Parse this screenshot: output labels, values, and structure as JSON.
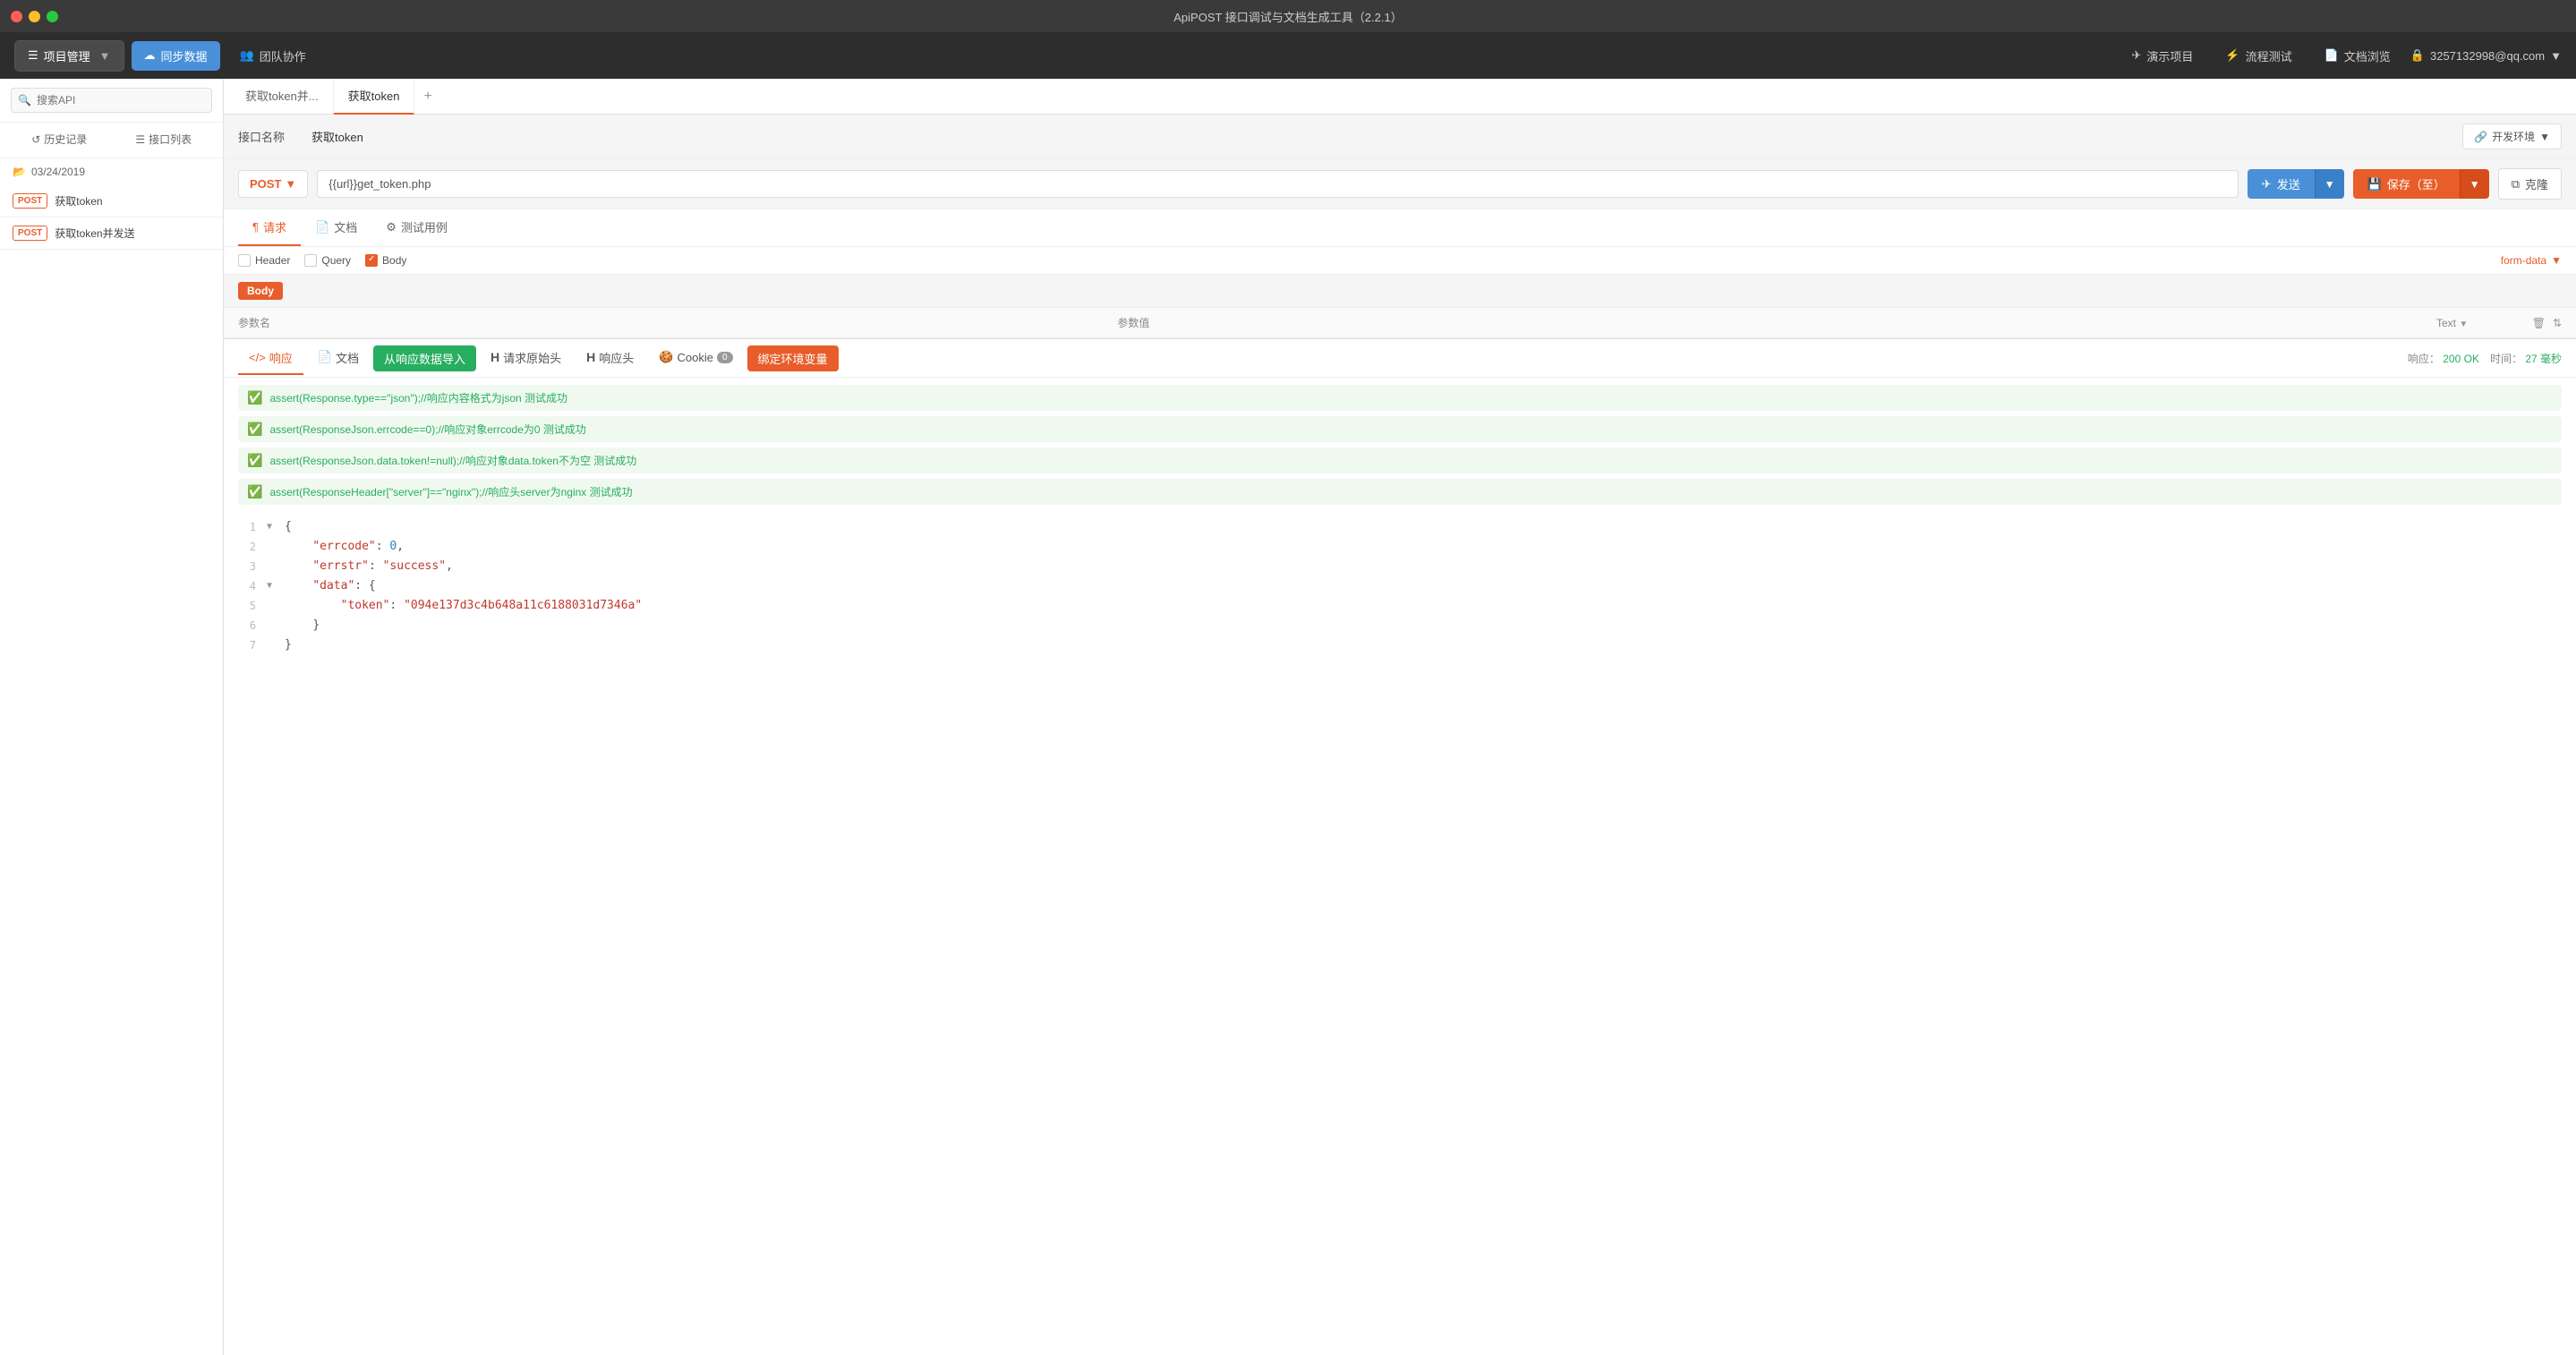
{
  "titlebar": {
    "title": "ApiPOST 接口调试与文档生成工具（2.2.1）"
  },
  "toolbar": {
    "project_mgmt": "项目管理",
    "sync_data": "同步数据",
    "team_collab": "团队协作",
    "demo_project": "演示项目",
    "flow_test": "流程测试",
    "doc_browse": "文档浏览",
    "user": "3257132998@qq.com"
  },
  "sidebar": {
    "search_placeholder": "搜索API",
    "nav": [
      {
        "label": "历史记录",
        "active": false
      },
      {
        "label": "接口列表",
        "active": false
      }
    ],
    "date": "03/24/2019",
    "items": [
      {
        "method": "POST",
        "label": "获取token"
      },
      {
        "method": "POST",
        "label": "获取token并发送"
      }
    ]
  },
  "tabs": [
    {
      "label": "获取token并...",
      "active": false
    },
    {
      "label": "获取token",
      "active": true
    }
  ],
  "api": {
    "name_label": "接口名称",
    "name_value": "获取token",
    "env_label": "开发环境",
    "method": "POST",
    "url": "{{url}}get_token.php"
  },
  "buttons": {
    "send": "发送",
    "save": "保存（至）",
    "clone": "克隆"
  },
  "request_tabs": [
    {
      "icon": "¶",
      "label": "请求",
      "active": true
    },
    {
      "icon": "📄",
      "label": "文档",
      "active": false
    },
    {
      "icon": "⚙",
      "label": "测试用例",
      "active": false
    }
  ],
  "filters": {
    "header": "Header",
    "query": "Query",
    "body": "Body",
    "form_data": "form-data"
  },
  "params": {
    "col_name": "参数名",
    "col_value": "参数值",
    "col_type": "Text"
  },
  "response": {
    "tabs": [
      {
        "label": "响应",
        "active": true,
        "icon": "<>"
      },
      {
        "label": "文档",
        "active": false,
        "icon": "📄"
      },
      {
        "label": "从响应数据导入",
        "type": "import"
      },
      {
        "label": "请求原始头",
        "active": false,
        "icon": "H"
      },
      {
        "label": "响应头",
        "active": false,
        "icon": "H"
      },
      {
        "label": "Cookie",
        "active": false,
        "count": "0",
        "icon": "🍪"
      },
      {
        "label": "绑定环境变量",
        "type": "bind-env"
      }
    ],
    "status": "200 OK",
    "time": "27 毫秒",
    "status_label": "响应：",
    "time_label": "时间："
  },
  "asserts": [
    {
      "text": "assert(Response.type==\"json\");//响应内容格式为json 测试成功"
    },
    {
      "text": "assert(ResponseJson.errcode==0);//响应对象errcode为0 测试成功"
    },
    {
      "text": "assert(ResponseJson.data.token!=null);//响应对象data.token不为空 测试成功"
    },
    {
      "text": "assert(ResponseHeader[\"server\"]==\"nginx\");//响应头server为nginx 测试成功"
    }
  ],
  "json_lines": [
    {
      "num": 1,
      "toggle": "▼",
      "content": "{",
      "type": "plain"
    },
    {
      "num": 2,
      "toggle": "",
      "content_key": "\"errcode\"",
      "content_sep": ": ",
      "content_val": "0,",
      "val_type": "num"
    },
    {
      "num": 3,
      "toggle": "",
      "content_key": "\"errstr\"",
      "content_sep": ": ",
      "content_val": "\"success\",",
      "val_type": "str"
    },
    {
      "num": 4,
      "toggle": "▼",
      "content_key": "\"data\"",
      "content_sep": ": ",
      "content_val": "{",
      "val_type": "plain"
    },
    {
      "num": 5,
      "toggle": "",
      "content_key": "\"token\"",
      "content_sep": ": ",
      "content_val": "\"094e137d3c4b648a11c6188031d7346a\"",
      "val_type": "str"
    },
    {
      "num": 6,
      "toggle": "",
      "content": "    }",
      "type": "plain"
    },
    {
      "num": 7,
      "toggle": "",
      "content": "}",
      "type": "plain"
    }
  ]
}
